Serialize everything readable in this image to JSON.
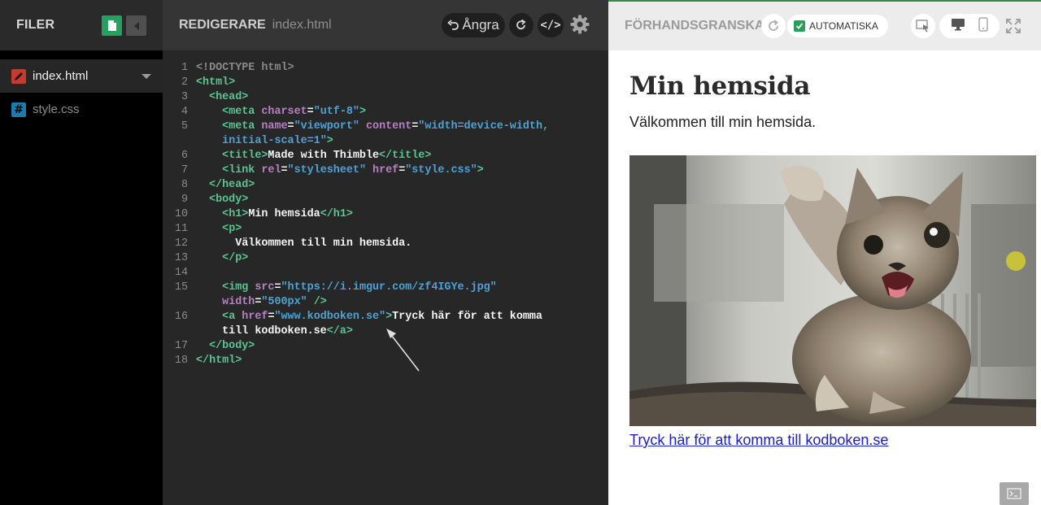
{
  "files_panel": {
    "title": "FILER",
    "files": [
      {
        "name": "index.html",
        "type": "html",
        "active": true
      },
      {
        "name": "style.css",
        "type": "css",
        "active": false
      }
    ]
  },
  "editor": {
    "title": "REDIGERARE",
    "filename": "index.html",
    "undo_label": "Ångra",
    "code_button_label": "</>"
  },
  "preview": {
    "title": "FÖRHANDSGRANSKA",
    "auto_label": "AUTOMATISKA",
    "auto_checked": true,
    "page_heading": "Min hemsida",
    "page_text": "Välkommen till min hemsida.",
    "link_text": "Tryck här för att komma till kodboken.se"
  },
  "icons": {
    "new_file": "new-file-icon",
    "collapse": "collapse-left-icon",
    "html_file": "pencil-icon",
    "css_file": "hash-icon",
    "undo": "undo-icon",
    "redo": "redo-icon",
    "code": "code-icon",
    "settings": "gear-icon",
    "refresh": "refresh-icon",
    "inspect": "inspect-icon",
    "desktop": "desktop-icon",
    "mobile": "mobile-icon",
    "fullscreen": "fullscreen-icon",
    "console": "console-icon"
  },
  "colors": {
    "accent_green": "#25a05f",
    "html_icon": "#c8392e",
    "css_icon": "#1c7cb0",
    "tag": "#5bc493",
    "attribute": "#b880c4",
    "value": "#4da3d6",
    "link": "#1b1bd0"
  }
}
